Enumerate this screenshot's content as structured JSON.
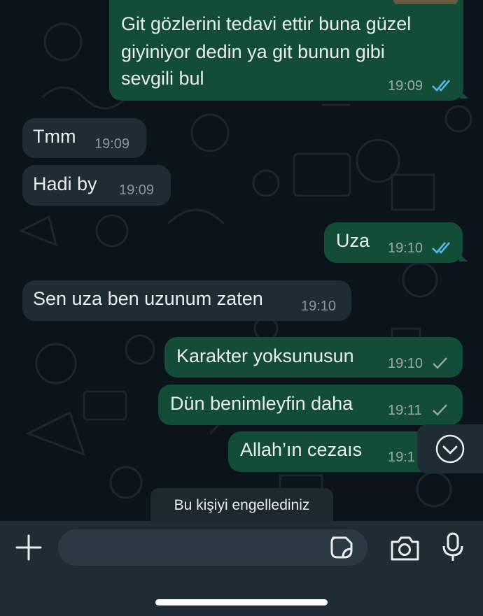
{
  "messages": [
    {
      "id": "m1",
      "direction": "outgoing",
      "text_lines": [
        "Git gözlerini tedavi ettir buna güzel",
        "giyiniyor dedin ya  git bunun gibi",
        "sevgili bul"
      ],
      "time": "19:09",
      "status": "read"
    },
    {
      "id": "m2",
      "direction": "incoming",
      "text": "Tmm",
      "time": "19:09"
    },
    {
      "id": "m3",
      "direction": "incoming",
      "text": "Hadi by",
      "time": "19:09"
    },
    {
      "id": "m4",
      "direction": "outgoing",
      "text": "Uza",
      "time": "19:10",
      "status": "read"
    },
    {
      "id": "m5",
      "direction": "incoming",
      "text": "Sen uza ben uzunum zaten",
      "time": "19:10"
    },
    {
      "id": "m6",
      "direction": "outgoing",
      "text": "Karakter yoksunusun",
      "time": "19:10",
      "status": "sent"
    },
    {
      "id": "m7",
      "direction": "outgoing",
      "text": "Dün benimleyfin daha",
      "time": "19:11",
      "status": "sent"
    },
    {
      "id": "m8",
      "direction": "outgoing",
      "text": "Allah’ın cezaıs",
      "time": "19:1"
    }
  ],
  "notice": {
    "text": "Bu kişiyi engellediniz"
  },
  "input_bar": {
    "placeholder": "",
    "icons": [
      "plus-icon",
      "sticker-icon",
      "camera-icon",
      "microphone-icon"
    ]
  },
  "scroll_button": {
    "icon": "chevron-down-circle-icon"
  },
  "colors": {
    "background": "#0b141a",
    "outgoing_bubble": "#144d37",
    "incoming_bubble": "#202c33",
    "read_ticks": "#53bdeb",
    "bar": "#1f2c33"
  }
}
